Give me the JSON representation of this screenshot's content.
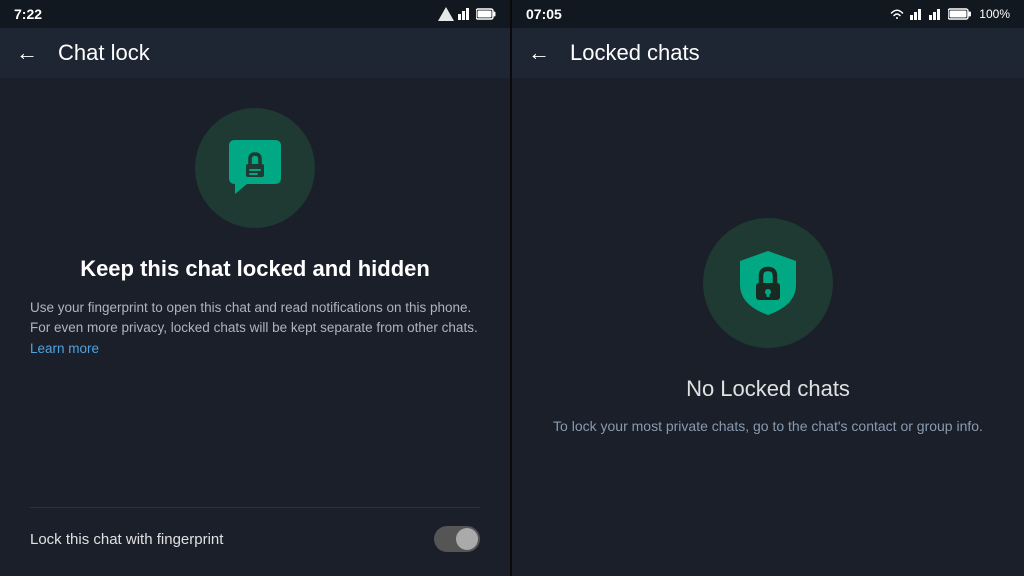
{
  "left": {
    "statusBar": {
      "time": "7:22",
      "icons": "▼▲▌"
    },
    "appBar": {
      "backLabel": "←",
      "title": "Chat lock"
    },
    "icon": {
      "name": "chat-lock-icon"
    },
    "headline": "Keep this chat locked and hidden",
    "bodyText": "Use your fingerprint to open this chat and read notifications on this phone. For even more privacy, locked chats will be kept separate from other chats.",
    "learnMore": "Learn more",
    "toggleLabel": "Lock this chat with fingerprint"
  },
  "right": {
    "statusBar": {
      "time": "07:05",
      "wifi": "WiFi",
      "signal1": "▌▌▌",
      "signal2": "▌▌▌",
      "battery": "100%"
    },
    "appBar": {
      "backLabel": "←",
      "title": "Locked chats"
    },
    "headline": "No Locked chats",
    "bodyText": "To lock your most private chats, go to the chat's contact or group info."
  }
}
